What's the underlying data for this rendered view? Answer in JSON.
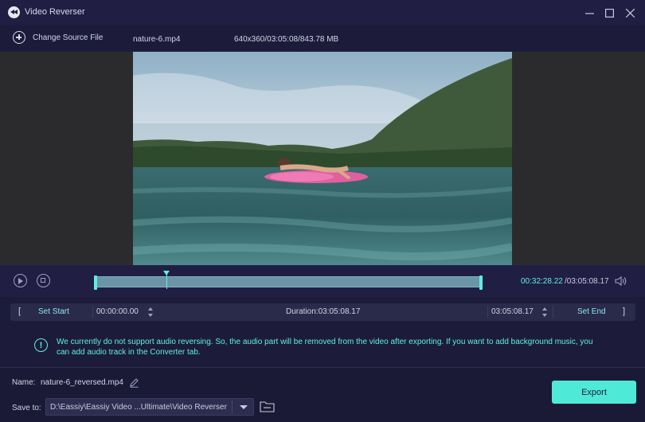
{
  "window": {
    "title": "Video Reverser",
    "minimize_icon": "minimize-icon",
    "maximize_icon": "maximize-icon",
    "close_icon": "close-icon"
  },
  "source": {
    "change_label": "Change Source File",
    "filename": "nature-6.mp4",
    "info": "640x360/03:05:08/843.78 MB"
  },
  "playback": {
    "current_time": "00:32:28.22",
    "total_time": "/03:05:08.17"
  },
  "clip": {
    "open_bracket": "[",
    "set_start_label": "Set Start",
    "start_time": "00:00:00.00",
    "duration_label": "Duration:03:05:08.17",
    "end_time": "03:05:08.17",
    "set_end_label": "Set End",
    "close_bracket": "]"
  },
  "notice": {
    "icon": "!",
    "text": "We currently do not support audio reversing. So, the audio part will be removed from the video after exporting. If you want to add background music, you can add audio track in the Converter tab."
  },
  "output": {
    "name_label": "Name:",
    "name_value": "nature-6_reversed.mp4",
    "save_label": "Save to:",
    "save_path": "D:\\Eassiy\\Eassiy Video ...Ultimate\\Video Reverser",
    "export_label": "Export"
  },
  "colors": {
    "accent": "#5ef0df",
    "background": "#1c1c3a",
    "titlebar": "#211e44",
    "export_button": "#4fe9d8"
  }
}
